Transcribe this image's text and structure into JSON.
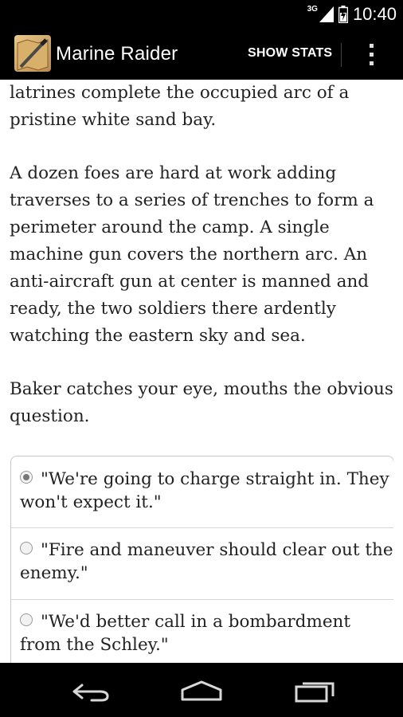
{
  "status_bar": {
    "network_label": "3G",
    "time": "10:40"
  },
  "action_bar": {
    "title": "Marine Raider",
    "show_stats_label": "SHOW STATS"
  },
  "content": {
    "paragraphs": [
      "latrines complete the occupied arc of a pristine white sand bay.",
      "A dozen foes are hard at work adding traverses to a series of trenches to form a perimeter around the camp. A single machine gun covers the northern arc. An anti-aircraft gun at center is manned and ready, the two soldiers there ardently watching the eastern sky and sea.",
      "Baker catches your eye, mouths the obvious question."
    ],
    "choices": [
      {
        "label": "\"We're going to charge straight in. They won't expect it.\"",
        "selected": true
      },
      {
        "label": "\"Fire and maneuver should clear out the enemy.\"",
        "selected": false
      },
      {
        "label": "\"We'd better call in a bombardment from the Schley.\"",
        "selected": false
      }
    ]
  },
  "icons": {
    "signal": "signal-icon",
    "battery": "battery-icon",
    "app": "app-icon",
    "overflow": "overflow-menu-icon",
    "back": "back-icon",
    "home": "home-icon",
    "recents": "recents-icon"
  }
}
